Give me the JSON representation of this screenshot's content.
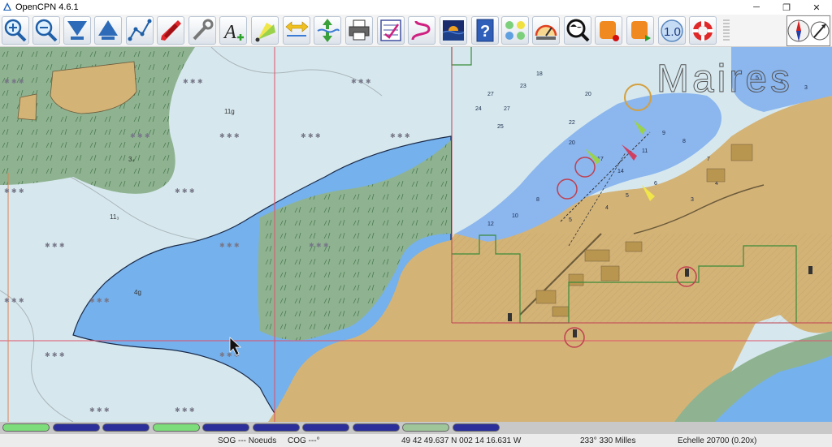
{
  "window": {
    "title": "OpenCPN 4.6.1",
    "minimize_glyph": "─",
    "maximize_glyph": "❐",
    "close_glyph": "✕"
  },
  "toolbar": {
    "items": [
      {
        "name": "zoom-in-button",
        "icon": "zoom-in-icon"
      },
      {
        "name": "zoom-out-button",
        "icon": "zoom-out-icon"
      },
      {
        "name": "scale-in-button",
        "icon": "scale-in-icon"
      },
      {
        "name": "scale-out-button",
        "icon": "scale-out-icon"
      },
      {
        "name": "route-button",
        "icon": "route-icon"
      },
      {
        "name": "auto-follow-button",
        "icon": "ship-icon"
      },
      {
        "name": "settings-button",
        "icon": "wrench-icon"
      },
      {
        "name": "text-button",
        "icon": "text-add-icon"
      },
      {
        "name": "lights-button",
        "icon": "light-icon"
      },
      {
        "name": "current-button",
        "icon": "current-arrows-icon"
      },
      {
        "name": "tide-button",
        "icon": "tide-icon"
      },
      {
        "name": "print-button",
        "icon": "printer-icon"
      },
      {
        "name": "route-manager-button",
        "icon": "checklist-icon"
      },
      {
        "name": "track-button",
        "icon": "track-icon"
      },
      {
        "name": "color-scheme-button",
        "icon": "color-scheme-icon"
      },
      {
        "name": "help-button",
        "icon": "help-icon"
      },
      {
        "name": "ais-button",
        "icon": "ais-icon"
      },
      {
        "name": "dashboard-button",
        "icon": "dashboard-icon"
      },
      {
        "name": "globe-button",
        "icon": "globe-search-icon"
      },
      {
        "name": "record-button",
        "icon": "record-icon"
      },
      {
        "name": "play-button",
        "icon": "play-icon"
      },
      {
        "name": "scale-one-button",
        "icon": "scale-one-icon"
      },
      {
        "name": "mob-button",
        "icon": "lifebuoy-icon"
      }
    ],
    "scale_one_label": "1.0",
    "help_label": "?",
    "text_label": "A"
  },
  "chart": {
    "watermark": "Maires",
    "depth_labels": [
      "11g",
      "3₄",
      "11₃",
      "4g"
    ],
    "colors": {
      "shallow": "#d6e8ee",
      "deep": "#75b1ec",
      "land": "#d4b377",
      "drying": "#8fb391",
      "cell_border": "#e0506a"
    }
  },
  "piano": {
    "keys": [
      {
        "color": "#7ddd7a"
      },
      {
        "color": "#2c2f9a"
      },
      {
        "color": "#2c2f9a"
      },
      {
        "color": "#7ddd7a"
      },
      {
        "color": "#2c2f9a"
      },
      {
        "color": "#2c2f9a"
      },
      {
        "color": "#2c2f9a"
      },
      {
        "color": "#2c2f9a"
      },
      {
        "color": "#9fc59a"
      },
      {
        "color": "#2c2f9a"
      }
    ]
  },
  "status": {
    "sog": "SOG --- Noeuds",
    "cog": "COG ---°",
    "position": "49 42 49.637 N   002 14 16.631 W",
    "bearing": "233°  330 Milles",
    "scale": "Echelle 20700 (0.20x)"
  }
}
